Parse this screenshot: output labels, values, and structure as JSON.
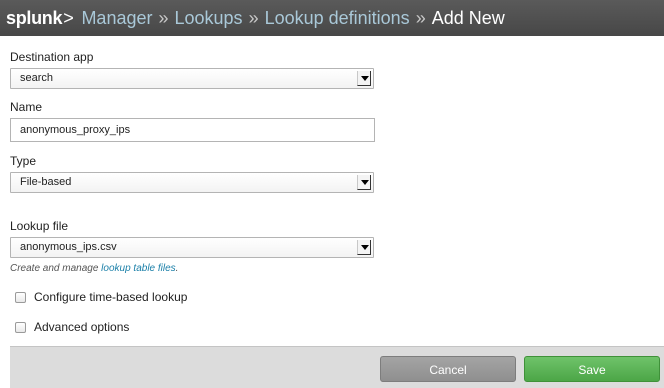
{
  "header": {
    "logo": "splunk",
    "logo_suffix": ">",
    "breadcrumbs": [
      "Manager",
      "Lookups",
      "Lookup definitions"
    ],
    "separator": "»",
    "current": "Add New"
  },
  "form": {
    "destination_app": {
      "label": "Destination app",
      "value": "search"
    },
    "name": {
      "label": "Name",
      "value": "anonymous_proxy_ips"
    },
    "type": {
      "label": "Type",
      "value": "File-based"
    },
    "lookup_file": {
      "label": "Lookup file",
      "value": "anonymous_ips.csv",
      "help_prefix": "Create and manage ",
      "help_link": "lookup table files",
      "help_suffix": "."
    },
    "time_based": {
      "label": "Configure time-based lookup",
      "checked": false
    },
    "advanced": {
      "label": "Advanced options",
      "checked": false
    }
  },
  "footer": {
    "cancel_label": "Cancel",
    "save_label": "Save"
  }
}
